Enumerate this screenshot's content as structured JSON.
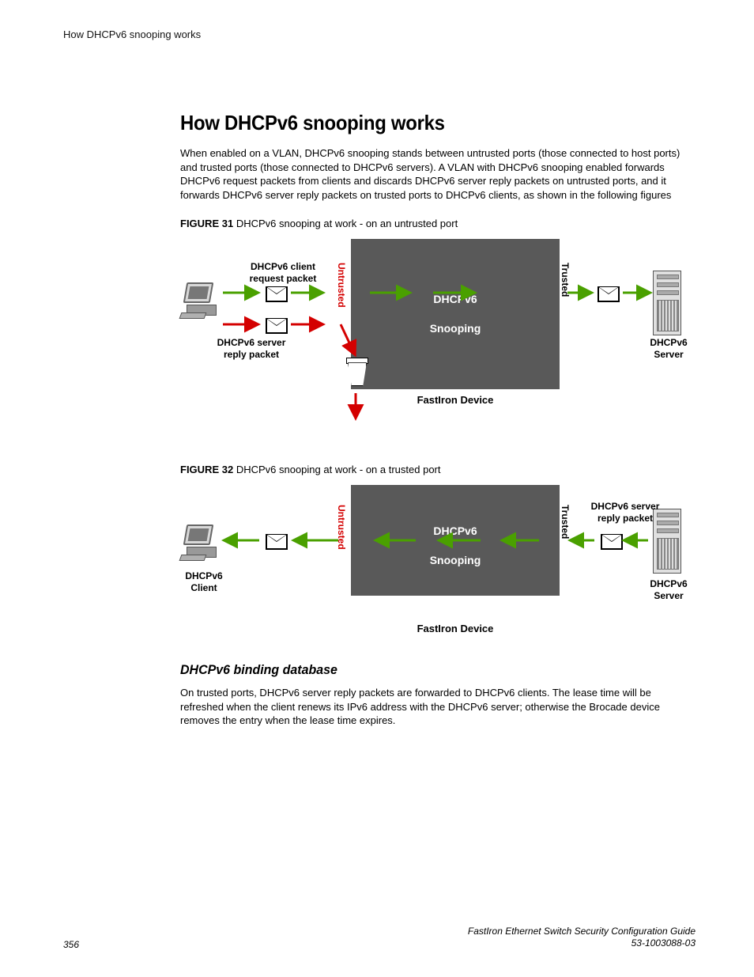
{
  "runningHeader": "How DHCPv6 snooping works",
  "title": "How DHCPv6 snooping works",
  "intro": "When enabled on a VLAN, DHCPv6 snooping stands between untrusted ports (those connected to host ports) and trusted ports (those connected to DHCPv6 servers). A VLAN with DHCPv6 snooping enabled forwards DHCPv6 request packets from clients and discards DHCPv6 server reply packets on untrusted ports, and it forwards DHCPv6 server reply packets on trusted ports to DHCPv6 clients, as shown in the following figures",
  "figure31": {
    "captionPrefix": "FIGURE 31",
    "captionText": "DHCPv6 snooping at work - on an untrusted port",
    "clientRequestLabel": "DHCPv6 client\nrequest packet",
    "replyPacketLabel": "DHCPv6 server\nreply packet",
    "untrusted": "Untrusted",
    "trusted": "Trusted",
    "boxLine1": "DHCPv6",
    "boxLine2": "Snooping",
    "deviceCaption": "FastIron Device",
    "serverLabel": "DHCPv6\nServer"
  },
  "figure32": {
    "captionPrefix": "FIGURE 32",
    "captionText": "DHCPv6 snooping at work - on a trusted port",
    "clientLabel": "DHCPv6\nClient",
    "replyPacketLabel": "DHCPv6 server\nreply packet",
    "untrusted": "Untrusted",
    "trusted": "Trusted",
    "boxLine1": "DHCPv6",
    "boxLine2": "Snooping",
    "deviceCaption": "FastIron Device",
    "serverLabel": "DHCPv6\nServer"
  },
  "subsectionTitle": "DHCPv6 binding database",
  "subsectionBody": "On trusted ports, DHCPv6 server reply packets are forwarded to DHCPv6 clients. The lease time will be refreshed when the client renews its IPv6 address with the DHCPv6 server; otherwise the Brocade device removes the entry when the lease time expires.",
  "footer": {
    "pageNumber": "356",
    "guide": "FastIron Ethernet Switch Security Configuration Guide",
    "docId": "53-1003088-03"
  }
}
